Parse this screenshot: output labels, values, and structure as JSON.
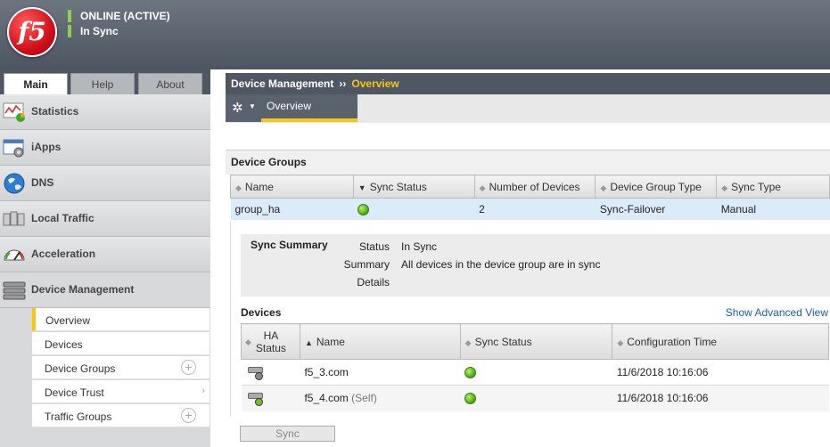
{
  "header": {
    "logo_text": "f5",
    "status": "ONLINE (ACTIVE)",
    "sync": "In Sync",
    "status_color": "#8fd04a"
  },
  "left_tabs": [
    {
      "label": "Main",
      "active": true
    },
    {
      "label": "Help"
    },
    {
      "label": "About"
    }
  ],
  "nav": [
    {
      "label": "Statistics",
      "icon": "statistics-chart-icon"
    },
    {
      "label": "iApps",
      "icon": "iapps-gear-window-icon"
    },
    {
      "label": "DNS",
      "icon": "globe-icon"
    },
    {
      "label": "Local Traffic",
      "icon": "local-traffic-icon"
    },
    {
      "label": "Acceleration",
      "icon": "speedometer-icon"
    },
    {
      "label": "Device Management",
      "icon": "server-stack-icon"
    }
  ],
  "subnav": [
    {
      "label": "Overview",
      "active": true
    },
    {
      "label": "Devices"
    },
    {
      "label": "Device Groups",
      "plus": true
    },
    {
      "label": "Device Trust",
      "chevron": true
    },
    {
      "label": "Traffic Groups",
      "plus": true
    }
  ],
  "breadcrumb": {
    "section": "Device Management",
    "separator": "››",
    "current": "Overview"
  },
  "tool_row": {
    "tab": "Overview"
  },
  "device_groups": {
    "title": "Device Groups",
    "columns": [
      "Name",
      "Sync Status",
      "Number of Devices",
      "Device Group Type",
      "Sync Type"
    ],
    "rows": [
      {
        "name": "group_ha",
        "sync_status": "green",
        "devices": "2",
        "type": "Sync-Failover",
        "sync_type": "Manual"
      }
    ]
  },
  "sync_summary": {
    "title": "Sync Summary",
    "status_label": "Status",
    "status_value": "In Sync",
    "summary_label": "Summary",
    "summary_value": "All devices in the device group are in sync",
    "details_label": "Details"
  },
  "devices": {
    "title": "Devices",
    "advanced_link": "Show Advanced View",
    "columns": [
      "HA Status",
      "Name",
      "Sync Status",
      "Configuration Time"
    ],
    "rows": [
      {
        "ha": "grey",
        "name": "f5_3.com",
        "self": "",
        "sync": "green",
        "time": "11/6/2018 10:16:06"
      },
      {
        "ha": "green",
        "name": "f5_4.com",
        "self": "(Self)",
        "sync": "green",
        "time": "11/6/2018 10:16:06"
      }
    ]
  },
  "actions": {
    "sync_button": "Sync"
  },
  "colors": {
    "accent": "#f5c518",
    "header_bg": "#4f5862",
    "link": "#1560b0"
  }
}
